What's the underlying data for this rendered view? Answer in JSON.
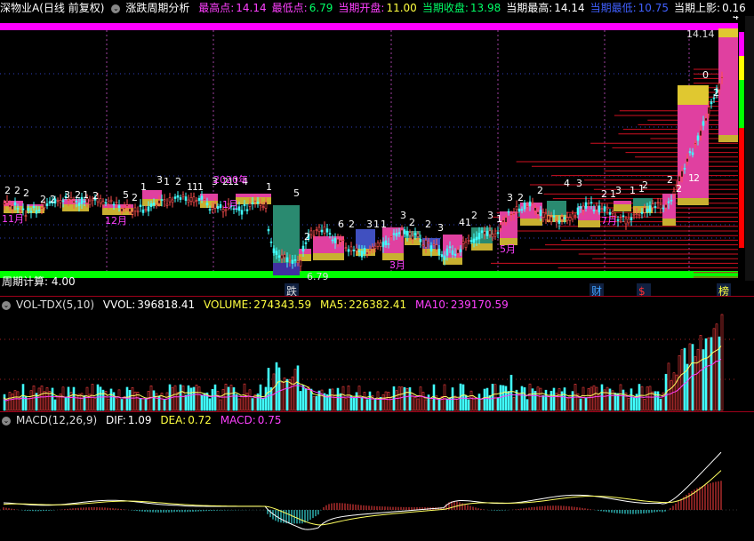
{
  "header": {
    "stock_name": "深物业A(日线 前复权)",
    "indicator": "涨跌周期分析",
    "stats": [
      {
        "label": "最高点:",
        "value": "14.14",
        "label_color": "#ff40ff",
        "value_color": "#ff40ff"
      },
      {
        "label": "最低点:",
        "value": "6.79",
        "label_color": "#ff40ff",
        "value_color": "#00ff66"
      },
      {
        "label": "当期开盘:",
        "value": "11.00",
        "label_color": "#ff40ff",
        "value_color": "#ffff40"
      },
      {
        "label": "当期收盘:",
        "value": "13.98",
        "label_color": "#00ff66",
        "value_color": "#00ff66"
      },
      {
        "label": "当期最高:",
        "value": "14.14",
        "label_color": "#ffffff",
        "value_color": "#ffffff"
      },
      {
        "label": "当期最低:",
        "value": "10.75",
        "label_color": "#4060ff",
        "value_color": "#4060ff"
      },
      {
        "label": "当期上影:",
        "value": "0.16",
        "label_color": "#ffffff",
        "value_color": "#ffffff"
      }
    ]
  },
  "main": {
    "period_label": "周期计算:",
    "period_value": "4.00",
    "month_labels": [
      "11月",
      "12月",
      "2020年",
      "1月",
      "3月",
      "5月",
      "7月"
    ],
    "price_labels": [
      "14.14",
      "6.79"
    ],
    "events": [
      "跌",
      "财",
      "$",
      "榜"
    ],
    "count_labels": [
      "2",
      "2",
      "2",
      "2",
      "2",
      "3",
      "2",
      "1",
      "2",
      "5",
      "2",
      "1",
      "3",
      "1",
      "2",
      "1",
      "1",
      "1",
      "3",
      "2",
      "1",
      "1",
      "4",
      "1",
      "5",
      "2",
      "6",
      "2",
      "3",
      "1",
      "1",
      "3",
      "2",
      "2",
      "3",
      "4",
      "1",
      "2",
      "3",
      "1",
      "3",
      "2",
      "2",
      "4",
      "3",
      "2",
      "1",
      "3",
      "1",
      "1",
      "2",
      "2",
      "2",
      "1",
      "2",
      "0",
      "2",
      "4"
    ]
  },
  "volume": {
    "name": "VOL-TDX(5,10)",
    "vvol_label": "VVOL:",
    "vvol": "396818.41",
    "volume_label": "VOLUME:",
    "volume": "274343.59",
    "ma5_label": "MA5:",
    "ma5": "226382.41",
    "ma10_label": "MA10:",
    "ma10": "239170.59"
  },
  "macd": {
    "name": "MACD(12,26,9)",
    "dif_label": "DIF:",
    "dif": "1.09",
    "dea_label": "DEA:",
    "dea": "0.72",
    "macd_label": "MACD:",
    "macd": "0.75"
  },
  "colors": {
    "magenta": "#ff00ff",
    "green": "#00ff00",
    "up": "#ff4040",
    "down": "#40ffff",
    "yellow": "#ffff40",
    "pink": "#e040a0",
    "teal": "#2a8a70"
  }
}
